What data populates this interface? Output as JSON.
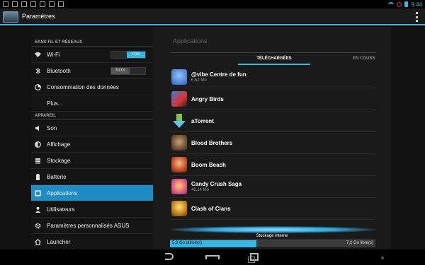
{
  "actionbar": {
    "title": "Paramètres"
  },
  "statusbar": {
    "time": "9:44"
  },
  "sidebar": {
    "section1": "SANS FIL ET RÉSEAUX",
    "section2": "APPAREIL",
    "items": [
      {
        "label": "Wi-Fi",
        "toggle": "OUI"
      },
      {
        "label": "Bluetooth",
        "toggle": "NON"
      },
      {
        "label": "Consommation des données"
      },
      {
        "label": "Plus..."
      },
      {
        "label": "Son"
      },
      {
        "label": "Affichage"
      },
      {
        "label": "Stockage"
      },
      {
        "label": "Batterie"
      },
      {
        "label": "Applications"
      },
      {
        "label": "Utilisateurs"
      },
      {
        "label": "Paramètres personnalisés ASUS"
      },
      {
        "label": "Launcher"
      }
    ]
  },
  "pane": {
    "title": "Applications",
    "tab_downloaded": "TÉLÉCHARGÉES",
    "tab_running": "EN COURS"
  },
  "apps": [
    {
      "name": "@vibe Centre de fun",
      "size": "6,62 Mo",
      "color": "#2f62b8"
    },
    {
      "name": "Angry Birds",
      "size": "",
      "color": "#3b7ed6"
    },
    {
      "name": "aTorrent",
      "size": "",
      "color": "#5fc6e8"
    },
    {
      "name": "Blood Brothers",
      "size": "",
      "color": "#7a5a3a"
    },
    {
      "name": "Boom Beach",
      "size": "",
      "color": "#c94a22"
    },
    {
      "name": "Candy Crush Saga",
      "size": "48,14 Mo",
      "color": "#e0608a"
    },
    {
      "name": "Clash of Clans",
      "size": "",
      "color": "#c7871f"
    }
  ],
  "storage": {
    "label": "Stockage interne",
    "used": "5,3 Go utilisé(s)",
    "free": "7,2 Go libre(s)",
    "used_fraction": 0.42
  },
  "colors": {
    "accent": "#33b5e5"
  }
}
